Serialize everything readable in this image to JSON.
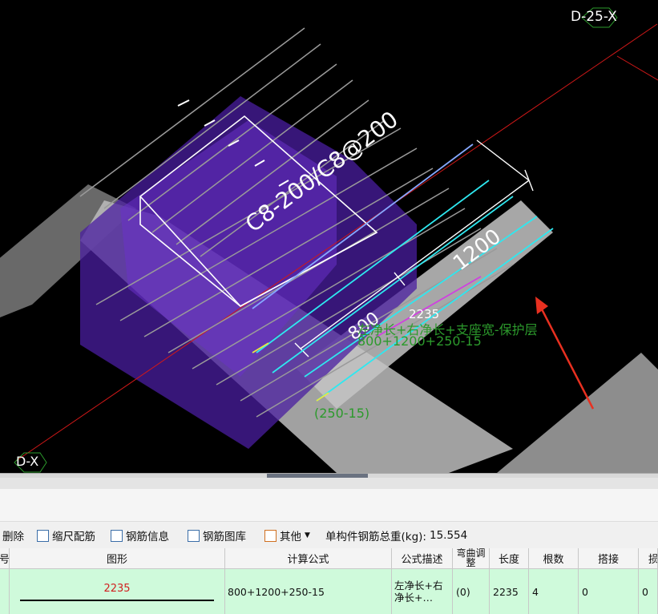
{
  "viewport": {
    "axis_top_right": "D-25-X",
    "axis_bottom_left": "D-X",
    "rebar_spec": "C8-200/C8@200",
    "dim_length": "1200",
    "dim_partial": "800",
    "rebar_length": "2235",
    "formula_desc": "左净长+右净长+支座宽-保护层",
    "formula_expr": "800+1200+250-15",
    "formula_partial": "(250-15)",
    "colors": {
      "background": "#000000",
      "beam": "#b4b4b4",
      "slab": "#5a2ab4",
      "rebar_cyan": "#2ee8f0",
      "axis_line": "#d01818",
      "annotation_green": "#2c9a2c",
      "arrow_red": "#e83020"
    }
  },
  "toolbar": {
    "delete": "删除",
    "scale_rebar": "缩尺配筋",
    "rebar_info": "钢筋信息",
    "rebar_library": "钢筋图库",
    "other": "其他",
    "total_weight_label": "单构件钢筋总重(kg):",
    "total_weight_value": "15.554"
  },
  "table": {
    "headers": [
      "号",
      "图形",
      "计算公式",
      "公式描述",
      "弯曲调整",
      "长度",
      "根数",
      "搭接",
      "损"
    ],
    "row": {
      "shape_value": "2235",
      "formula": "800+1200+250-15",
      "description": "左净长+右净长+…",
      "bend": "(0)",
      "length": "2235",
      "count": "4",
      "lap": "0",
      "loss": "0"
    }
  }
}
